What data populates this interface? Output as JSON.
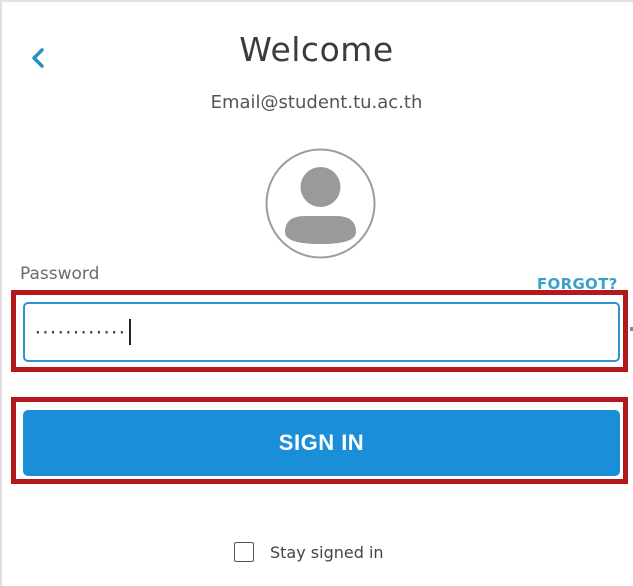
{
  "header": {
    "back_icon": "chevron-left-icon",
    "title": "Welcome",
    "email": "Email@student.tu.ac.th"
  },
  "avatar": {
    "icon": "user-avatar-icon"
  },
  "password": {
    "label": "Password",
    "forgot_label": "FORGOT?",
    "masked_value": "············"
  },
  "signin": {
    "label": "SIGN IN"
  },
  "stay_signed_in": {
    "label": "Stay signed in",
    "checked": false
  },
  "colors": {
    "accent": "#1a8ed6",
    "link": "#3aa0c8",
    "highlight": "#b3191c"
  }
}
